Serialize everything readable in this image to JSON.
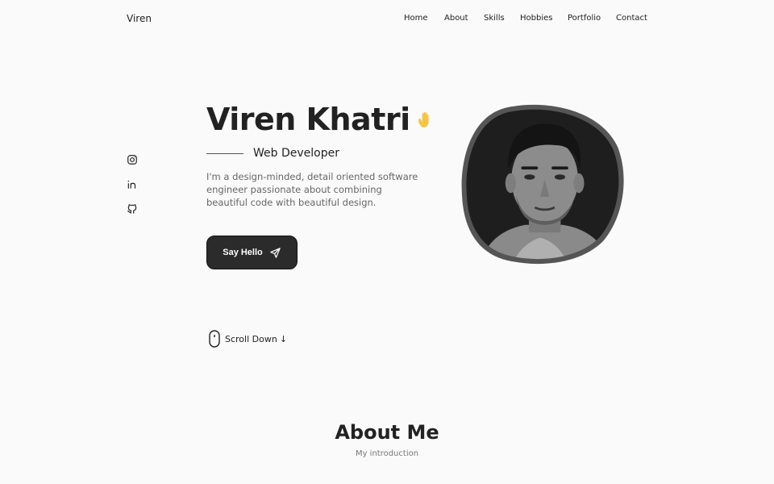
{
  "header": {
    "logo": "Viren",
    "nav": [
      {
        "label": "Home"
      },
      {
        "label": "About"
      },
      {
        "label": "Skills"
      },
      {
        "label": "Hobbies"
      },
      {
        "label": "Portfolio"
      },
      {
        "label": "Contact"
      }
    ]
  },
  "social": {
    "icons": [
      "instagram-icon",
      "linkedin-icon",
      "github-icon"
    ]
  },
  "hero": {
    "name": "Viren Khatri",
    "wave_icon": "waving-hand-icon",
    "role": "Web Developer",
    "description": "I'm a design-minded, detail oriented software engineer passionate about combining beautiful code with beautiful design.",
    "cta_label": "Say Hello",
    "cta_icon": "send-icon"
  },
  "scroll": {
    "label": "Scroll Down",
    "arrow": "↓"
  },
  "about": {
    "title": "About Me",
    "subtitle": "My introduction"
  },
  "colors": {
    "background": "#fafafa",
    "text": "#222222",
    "button": "#2b2b2b",
    "wave": "#f5c542"
  }
}
